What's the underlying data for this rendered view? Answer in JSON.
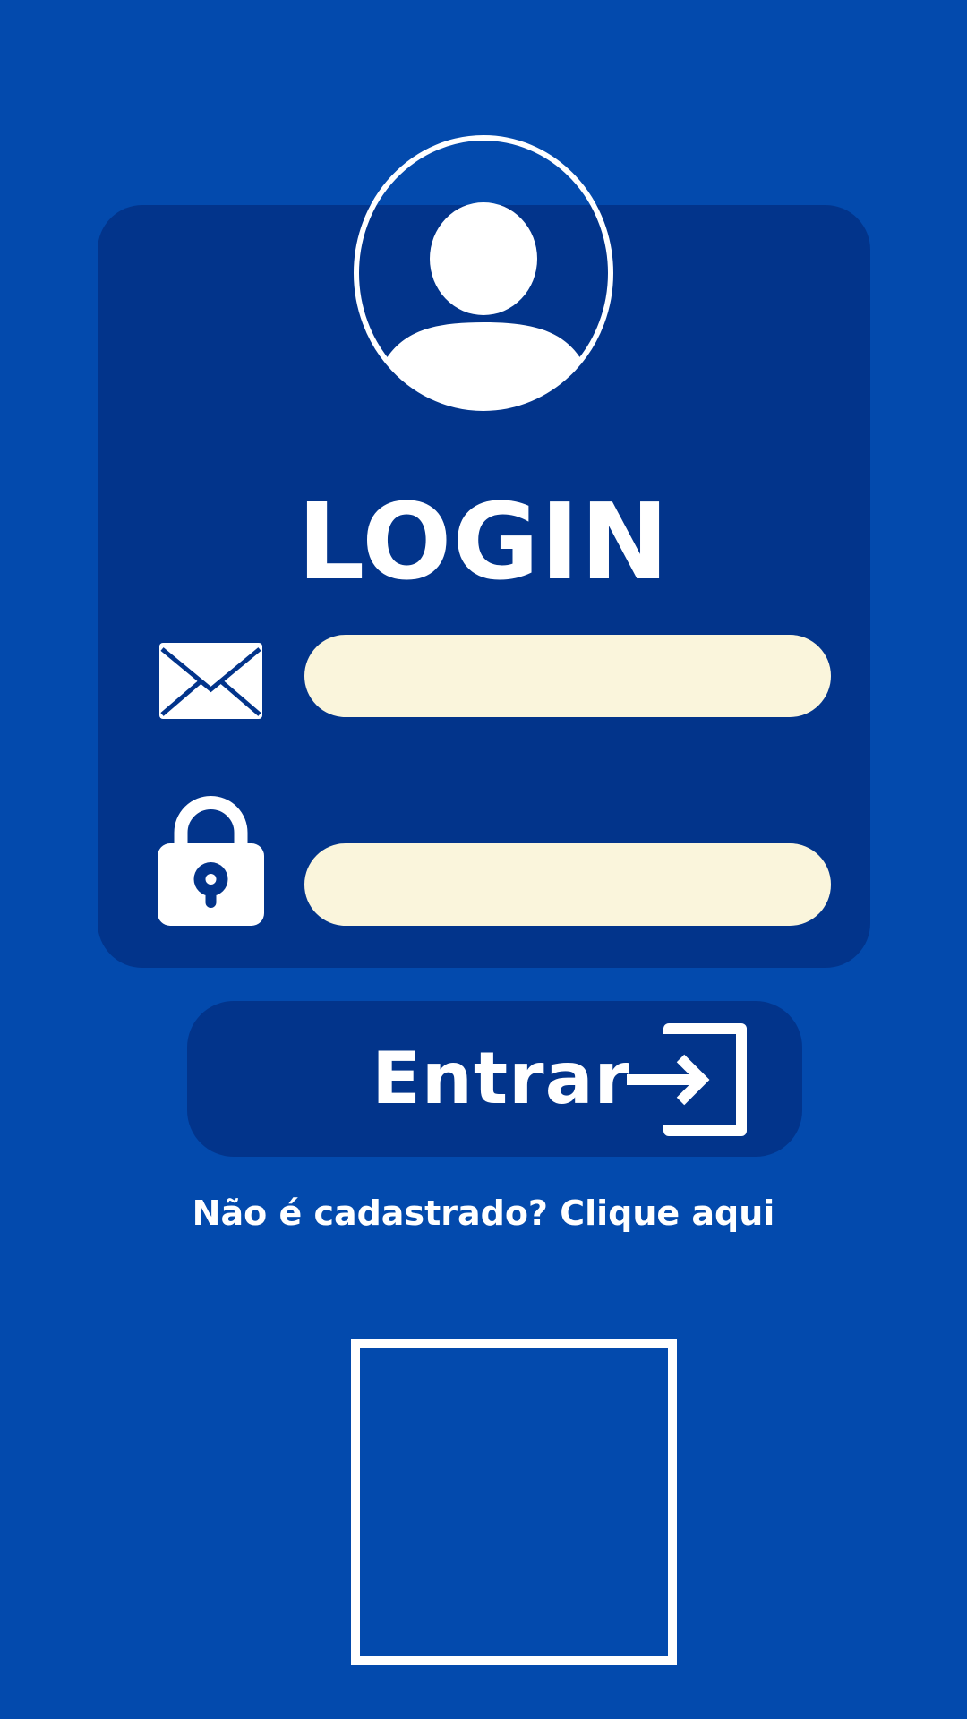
{
  "login": {
    "title": "LOGIN",
    "email_field": {
      "value": "",
      "placeholder": ""
    },
    "password_field": {
      "value": "",
      "placeholder": ""
    },
    "submit_label": "Entrar",
    "register_link": "Não é cadastrado? Clique aqui"
  },
  "icons": {
    "avatar": "user-avatar-icon",
    "email": "envelope-icon",
    "password": "lock-icon",
    "submit": "sign-in-icon"
  },
  "colors": {
    "background": "#034aad",
    "card": "#02348b",
    "input_fill": "#faf5dc",
    "foreground": "#ffffff"
  }
}
